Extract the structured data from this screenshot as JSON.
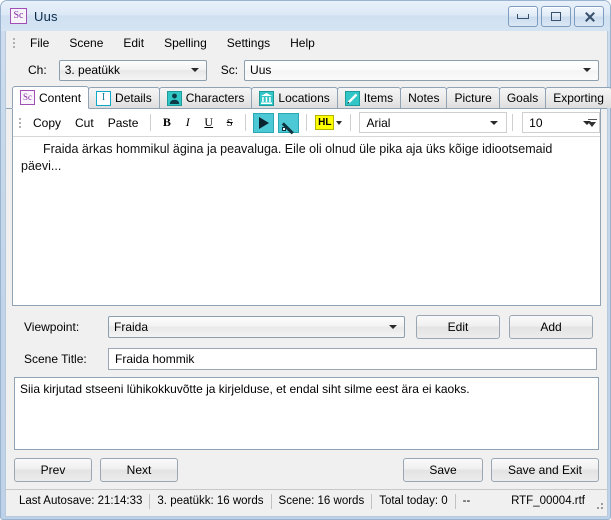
{
  "window": {
    "app_icon": "Sc",
    "title": "Uus",
    "buttons": {
      "minimize": "minimize-icon",
      "maximize": "maximize-icon",
      "close": "close-icon"
    }
  },
  "menubar": {
    "items": [
      {
        "label": "File"
      },
      {
        "label": "Scene"
      },
      {
        "label": "Edit"
      },
      {
        "label": "Spelling"
      },
      {
        "label": "Settings"
      },
      {
        "label": "Help"
      }
    ]
  },
  "selector": {
    "chapter_label": "Ch:",
    "chapter_value": "3. peatükk",
    "scene_label": "Sc:",
    "scene_value": "Uus"
  },
  "tabs": [
    {
      "label": "Content",
      "icon": "sc-icon",
      "active": true
    },
    {
      "label": "Details",
      "icon": "info-icon",
      "active": false
    },
    {
      "label": "Characters",
      "icon": "person-icon",
      "active": false
    },
    {
      "label": "Locations",
      "icon": "bank-icon",
      "active": false
    },
    {
      "label": "Items",
      "icon": "pen-icon",
      "active": false
    },
    {
      "label": "Notes",
      "icon": "",
      "active": false
    },
    {
      "label": "Picture",
      "icon": "",
      "active": false
    },
    {
      "label": "Goals",
      "icon": "",
      "active": false
    },
    {
      "label": "Exporting",
      "icon": "",
      "active": false
    }
  ],
  "editor_toolbar": {
    "copy": "Copy",
    "cut": "Cut",
    "paste": "Paste",
    "bold": "B",
    "italic": "I",
    "underline": "U",
    "strike": "S",
    "play_icon": "play-icon",
    "pen_icon": "pen-icon",
    "highlight_label": "HL",
    "font_family": "Arial",
    "font_size": "10",
    "overflow_icon": "toolbar-overflow-icon"
  },
  "content": {
    "body_text": "Fraida ärkas hommikul ägina ja peavaluga. Eile oli olnud üle pika aja üks kõige idiootsemaid päevi..."
  },
  "form": {
    "viewpoint_label": "Viewpoint:",
    "viewpoint_value": "Fraida",
    "edit_button": "Edit",
    "add_button": "Add",
    "scene_title_label": "Scene Title:",
    "scene_title_value": "Fraida hommik",
    "summary_text": "Siia kirjutad stseeni lühikokkuvõtte ja kirjelduse, et endal siht silme eest ära ei kaoks."
  },
  "bottom_buttons": {
    "prev": "Prev",
    "next": "Next",
    "save": "Save",
    "save_and_exit": "Save and Exit"
  },
  "statusbar": {
    "autosave": "Last Autosave: 21:14:33",
    "chapter_words": "3. peatükk: 16 words",
    "scene_words": "Scene: 16 words",
    "total_today": "Total today: 0",
    "extra": "--",
    "filename": "RTF_00004.rtf"
  },
  "colors": {
    "accent_teal": "#33c6c6",
    "accent_purple": "#8b2fa8",
    "highlight_yellow": "#ffff00",
    "frame_blue": "#c4d6ea"
  }
}
